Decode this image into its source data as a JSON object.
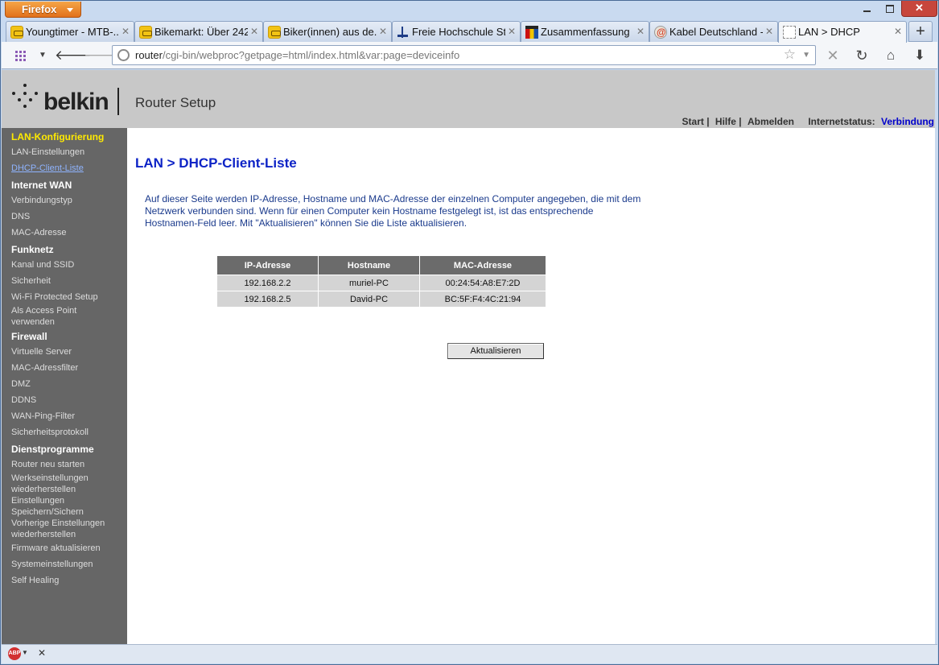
{
  "browser": {
    "menu_label": "Firefox",
    "tabs": [
      {
        "label": "Youngtimer - MTB-...",
        "icon": "bike-favicon-icon"
      },
      {
        "label": "Bikemarkt: Über 242...",
        "icon": "bike-favicon-icon"
      },
      {
        "label": "Biker(innen) aus de...",
        "icon": "bike-favicon-icon"
      },
      {
        "label": "Freie Hochschule St...",
        "icon": "hochschule-favicon-icon"
      },
      {
        "label": "Zusammenfassung",
        "icon": "zusammenfassung-favicon-icon"
      },
      {
        "label": "Kabel Deutschland -...",
        "icon": "kabel-favicon-icon"
      },
      {
        "label": "LAN > DHCP",
        "icon": "blank-page-icon"
      }
    ],
    "url_host": "router",
    "url_path": "/cgi-bin/webproc?getpage=html/index.html&var:page=deviceinfo"
  },
  "header": {
    "brand": "belkin",
    "subtitle": "Router Setup",
    "links": {
      "start": "Start |",
      "hilfe": "Hilfe |",
      "abmelden": "Abmelden",
      "status_label": "Internetstatus:",
      "status_value": "Verbindung"
    }
  },
  "sidebar": {
    "items": [
      {
        "label": "LAN-Konfigurierung"
      },
      {
        "label": "LAN-Einstellungen"
      },
      {
        "label": "DHCP-Client-Liste"
      },
      {
        "label": "Internet WAN"
      },
      {
        "label": "Verbindungstyp"
      },
      {
        "label": "DNS"
      },
      {
        "label": "MAC-Adresse"
      },
      {
        "label": "Funknetz"
      },
      {
        "label": "Kanal und SSID"
      },
      {
        "label": "Sicherheit"
      },
      {
        "label": "Wi-Fi Protected Setup"
      },
      {
        "label": "Als Access Point"
      },
      {
        "label": "verwenden"
      },
      {
        "label": "Firewall"
      },
      {
        "label": "Virtuelle Server"
      },
      {
        "label": "MAC-Adressfilter"
      },
      {
        "label": "DMZ"
      },
      {
        "label": "DDNS"
      },
      {
        "label": "WAN-Ping-Filter"
      },
      {
        "label": "Sicherheitsprotokoll"
      },
      {
        "label": "Dienstprogramme"
      },
      {
        "label": "Router neu starten"
      },
      {
        "label": "Werkseinstellungen"
      },
      {
        "label": "wiederherstellen"
      },
      {
        "label": "Einstellungen"
      },
      {
        "label": "Speichern/Sichern"
      },
      {
        "label": "Vorherige Einstellungen"
      },
      {
        "label": "wiederherstellen"
      },
      {
        "label": "Firmware aktualisieren"
      },
      {
        "label": "Systemeinstellungen"
      },
      {
        "label": "Self Healing"
      }
    ]
  },
  "main": {
    "title": "LAN > DHCP-Client-Liste",
    "description": "Auf dieser Seite werden IP-Adresse, Hostname und MAC-Adresse der einzelnen Computer angegeben, die mit dem Netzwerk verbunden sind. Wenn für einen Computer kein Hostname festgelegt ist, ist das entsprechende Hostnamen-Feld leer. Mit \"Aktualisieren\" können Sie die Liste aktualisieren.",
    "table": {
      "headers": [
        "IP-Adresse",
        "Hostname",
        "MAC-Adresse"
      ],
      "rows": [
        [
          "192.168.2.2",
          "muriel-PC",
          "00:24:54:A8:E7:2D"
        ],
        [
          "192.168.2.5",
          "David-PC",
          "BC:5F:F4:4C:21:94"
        ]
      ]
    },
    "refresh_button": "Aktualisieren"
  },
  "statusbar": {
    "abp_label": "ABP"
  }
}
